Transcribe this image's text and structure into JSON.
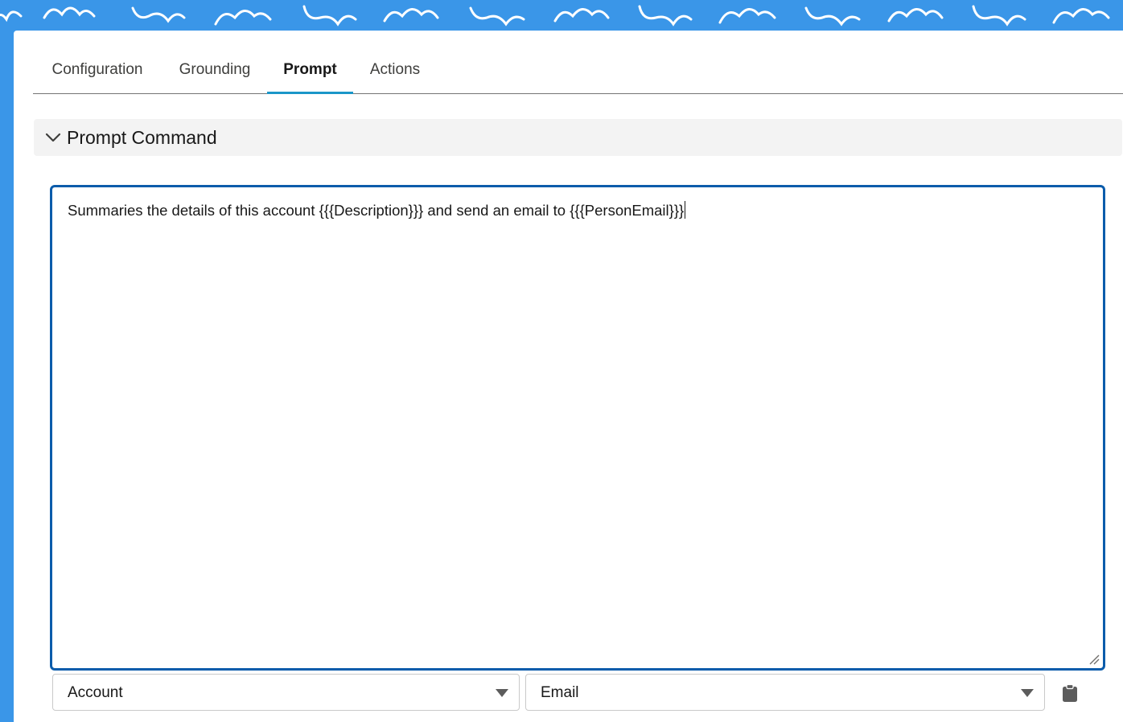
{
  "tabs": [
    {
      "label": "Configuration",
      "active": false
    },
    {
      "label": "Grounding",
      "active": false
    },
    {
      "label": "Prompt",
      "active": true
    },
    {
      "label": "Actions",
      "active": false
    }
  ],
  "section": {
    "title": "Prompt Command",
    "expanded": true,
    "icon": "chevron-down-icon"
  },
  "prompt": {
    "text": "Summaries the details of this account {{{Description}}} and send an email to {{{PersonEmail}}}"
  },
  "selectors": {
    "object_value": "Account",
    "field_value": "Email",
    "insert_icon": "clipboard-icon"
  },
  "colors": {
    "backdrop": "#3a96e8",
    "tab_active_underline": "#1b96c8",
    "editor_focus_border": "#0b5cab",
    "section_header_bg": "#f3f3f3"
  }
}
